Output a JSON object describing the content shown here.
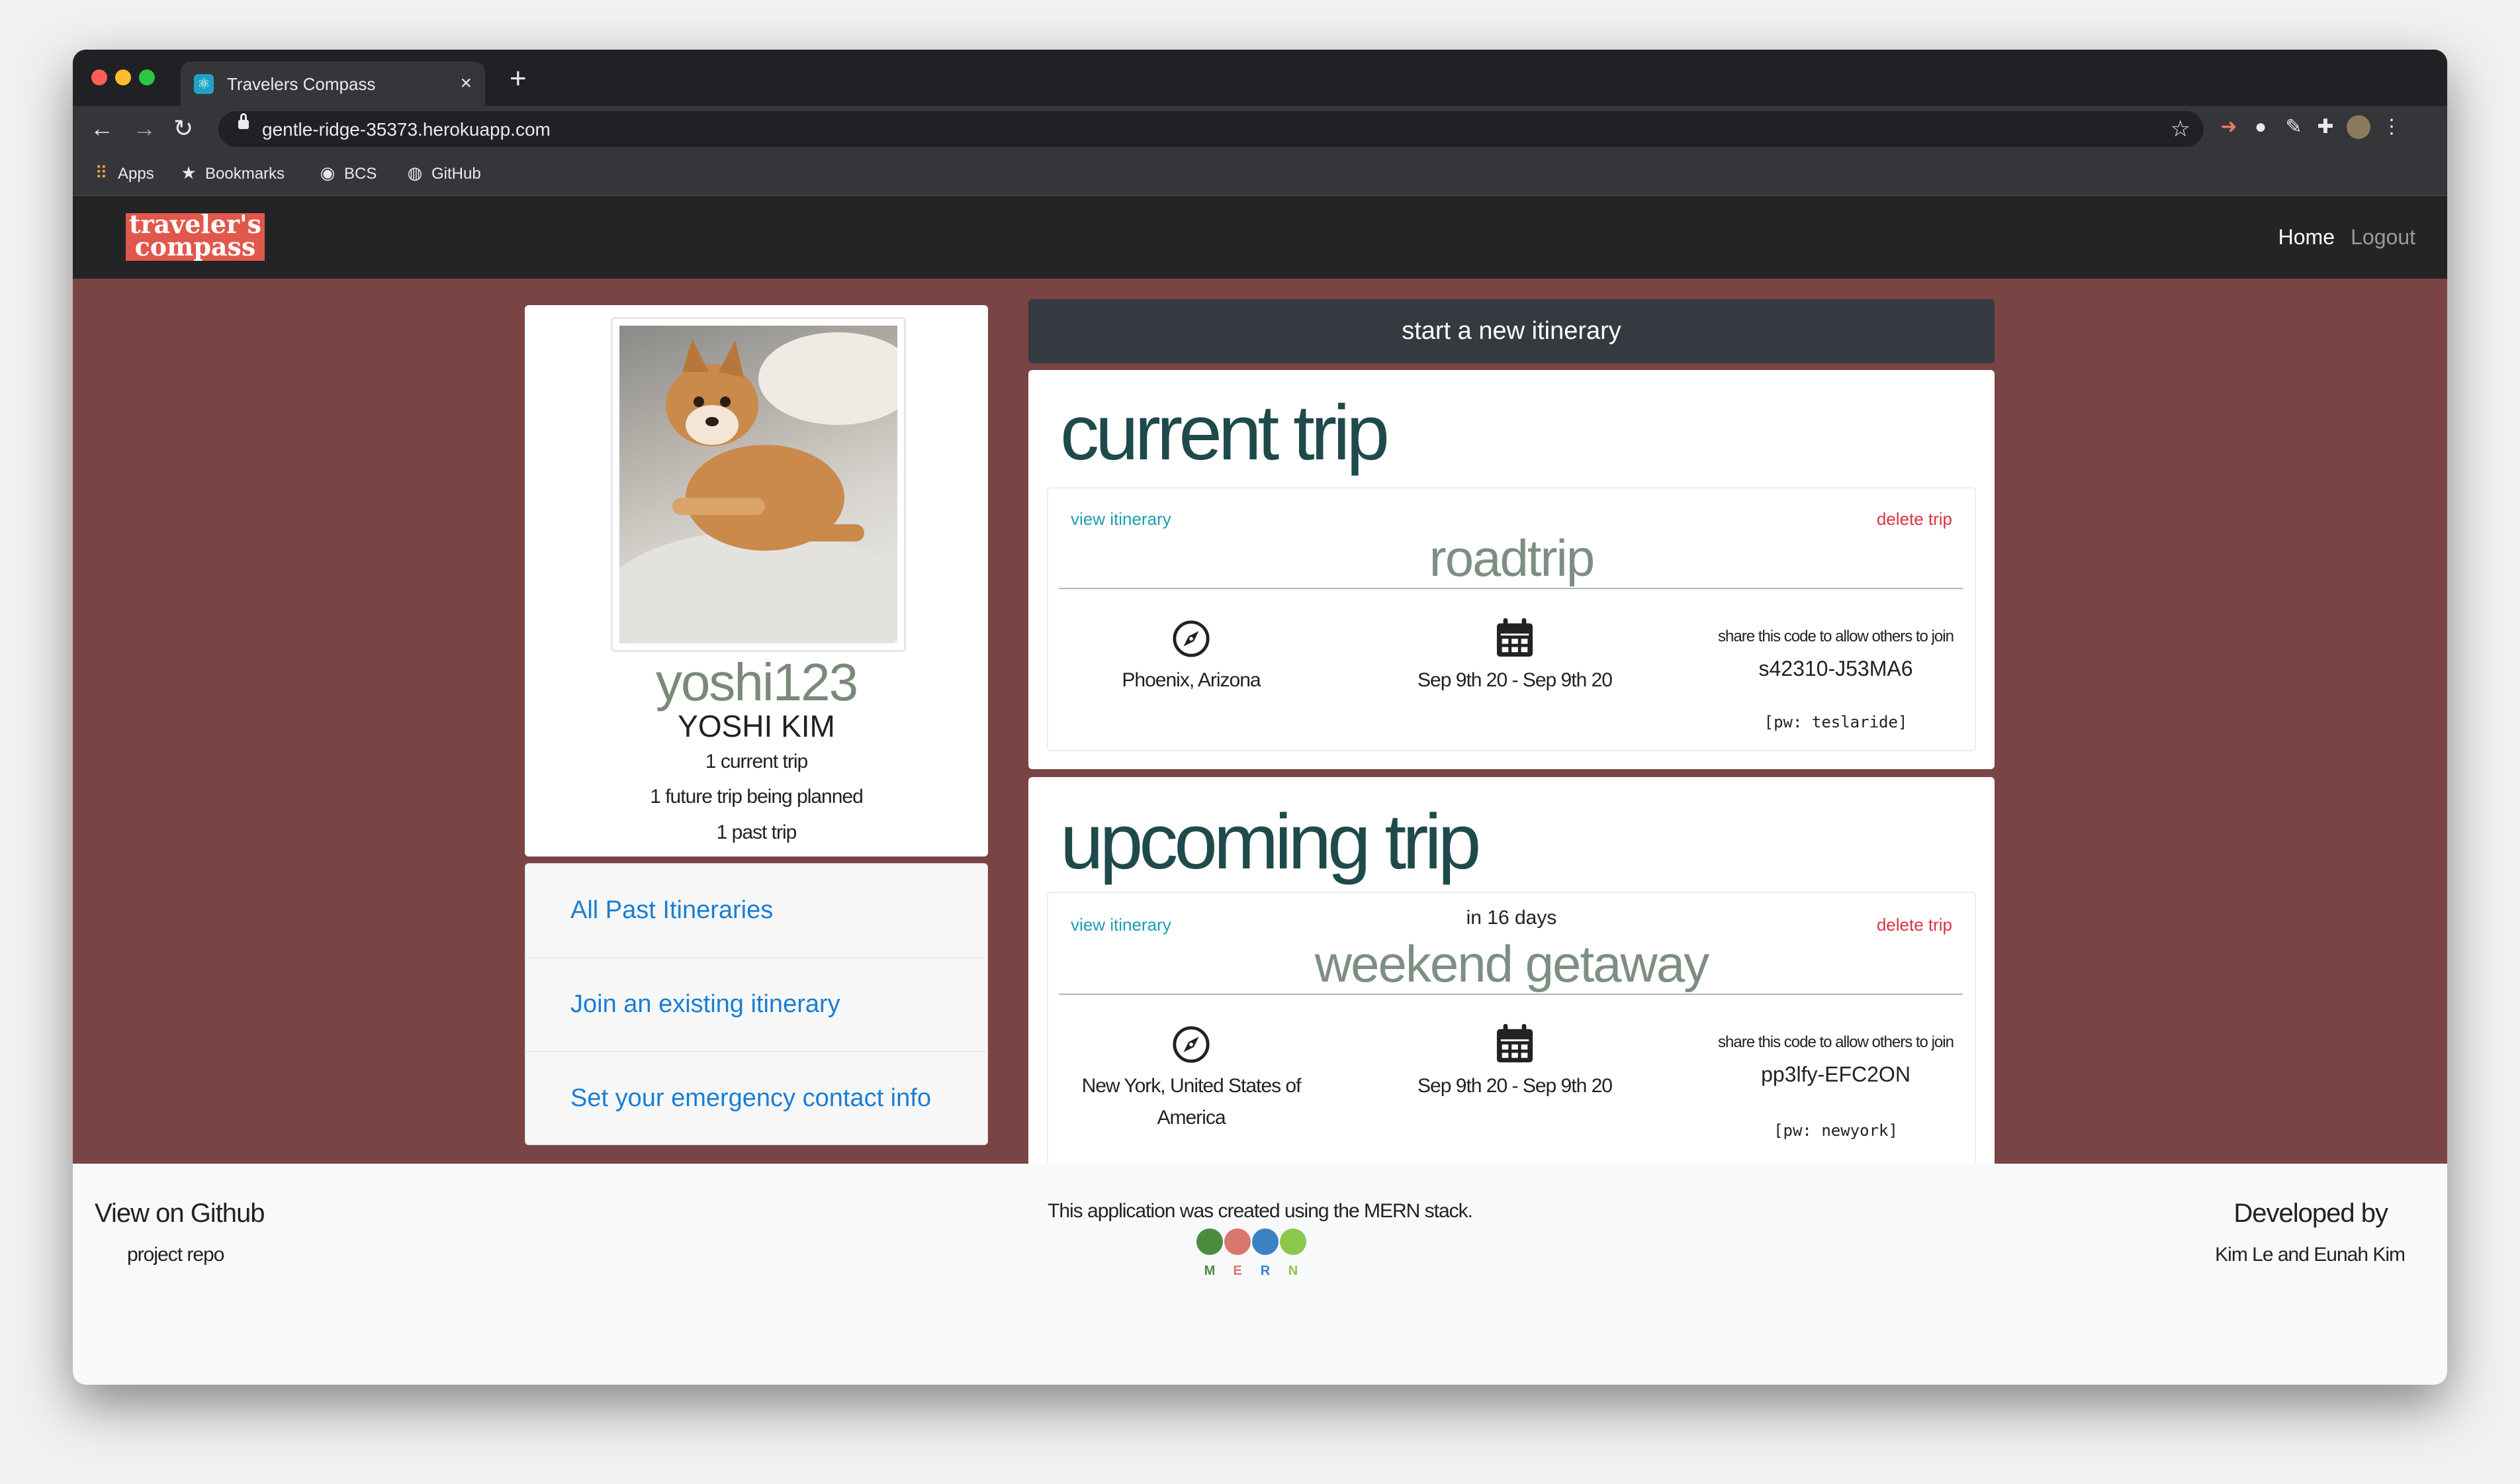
{
  "browser": {
    "tab_title": "Travelers Compass",
    "tab_close": "×",
    "new_tab": "+",
    "url": "gentle-ridge-35373.herokuapp.com",
    "bookmarks": [
      {
        "label": "Apps",
        "icon": "apps-grid-icon"
      },
      {
        "label": "Bookmarks",
        "icon": "star-icon"
      },
      {
        "label": "BCS",
        "icon": "globe-icon"
      },
      {
        "label": "GitHub",
        "icon": "github-icon"
      }
    ]
  },
  "app": {
    "logo_line1": "traveler's",
    "logo_line2": "compass",
    "nav": {
      "home": "Home",
      "logout": "Logout"
    }
  },
  "profile": {
    "username": "yoshi123",
    "full_name": "YOSHI KIM",
    "stats": [
      "1 current trip",
      "1 future trip being planned",
      "1 past trip"
    ]
  },
  "links": [
    "All Past Itineraries",
    "Join an existing itinerary",
    "Set your emergency contact info"
  ],
  "start_button": "start a new itinerary",
  "current_trip": {
    "heading": "current trip",
    "view": "view itinerary",
    "delete": "delete trip",
    "name": "roadtrip",
    "location": "Phoenix, Arizona",
    "dates": "Sep 9th 20 - Sep 9th 20",
    "share_label": "share this code to allow others to join",
    "code": "s42310-J53MA6",
    "pw": "[pw: teslaride]"
  },
  "upcoming_trip": {
    "heading": "upcoming trip",
    "countdown": "in 16 days",
    "view": "view itinerary",
    "delete": "delete trip",
    "name": "weekend getaway",
    "location_line1": "New York, United States of",
    "location_line2": "America",
    "dates": "Sep 9th 20 - Sep 9th 20",
    "share_label": "share this code to allow others to join",
    "code": "pp3lfy-EFC2ON",
    "pw": "[pw: newyork]"
  },
  "footer": {
    "github_title": "View on Github",
    "github_link": "project repo",
    "mern_text": "This application was created using the MERN stack.",
    "mern_letters": [
      "M",
      "E",
      "R",
      "N"
    ],
    "developed_by": "Developed by",
    "developers": "Kim Le and Eunah Kim"
  },
  "colors": {
    "page_background": "#7a4444",
    "navbar": "#222425",
    "logo": "#e2574c",
    "heading_teal": "#1f4a4c",
    "link_blue": "#1a7ed4",
    "delete_red": "#d9343f"
  }
}
